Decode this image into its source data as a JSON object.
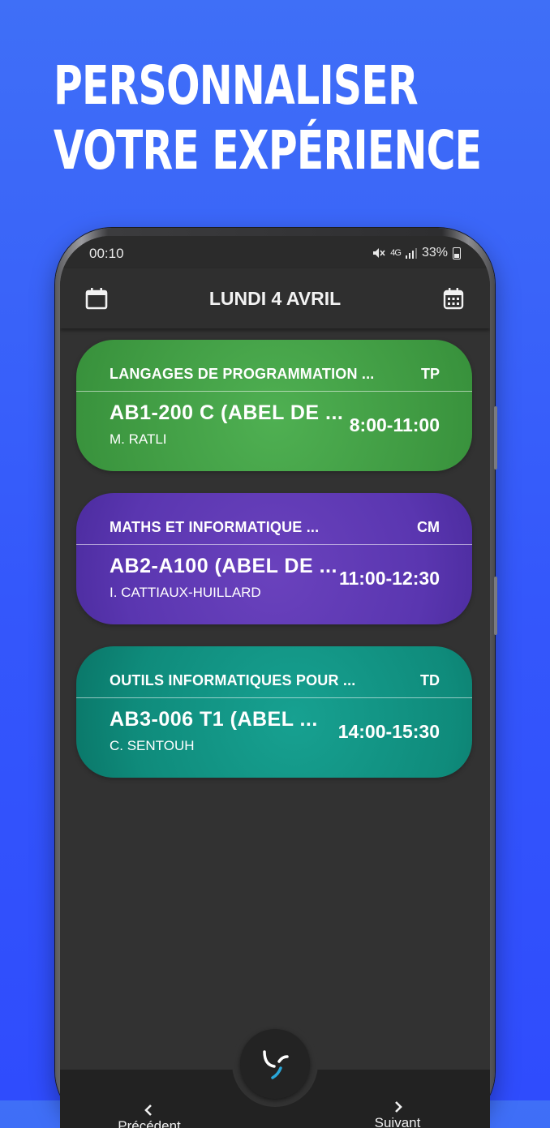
{
  "promo": {
    "line1": "PERSONNALISER",
    "line2": "VOTRE EXPÉRIENCE"
  },
  "status_bar": {
    "time": "00:10",
    "network": "4G",
    "battery": "33%"
  },
  "app_bar": {
    "title": "LUNDI 4 AVRIL",
    "left_icon": "calendar-outline-icon",
    "right_icon": "calendar-grid-icon"
  },
  "courses": [
    {
      "title": "LANGAGES DE PROGRAMMATION ...",
      "type": "TP",
      "room": "AB1-200 C (ABEL DE ...",
      "teacher": "M. RATLI",
      "time": "8:00-11:00",
      "color": "#43A047"
    },
    {
      "title": "MATHS ET INFORMATIQUE  ...",
      "type": "CM",
      "room": "AB2-A100 (ABEL DE ...",
      "teacher": "I. CATTIAUX-HUILLARD",
      "time": "11:00-12:30",
      "color": "#5E35B1"
    },
    {
      "title": "OUTILS INFORMATIQUES POUR ...",
      "type": "TD",
      "room": "AB3-006 T1 (ABEL  ...",
      "teacher": "C. SENTOUH",
      "time": "14:00-15:30",
      "color": "#00897B"
    }
  ],
  "bottom_nav": {
    "prev_label": "Précédent",
    "next_label": "Suivant",
    "center_icon": "app-logo-icon"
  }
}
